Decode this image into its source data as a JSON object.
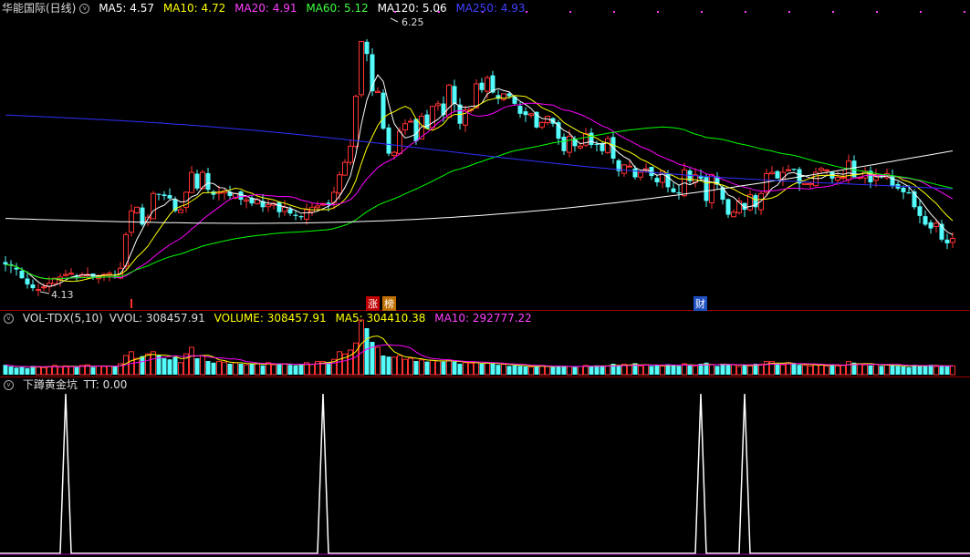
{
  "header": {
    "stock": "华能国际(日线)",
    "ma5": "MA5: 4.57",
    "ma10": "MA10: 4.72",
    "ma20": "MA20: 4.91",
    "ma60": "MA60: 5.12",
    "ma120": "MA120: 5.06",
    "ma250": "MA250: 4.93"
  },
  "vol_header": {
    "name": "VOL-TDX(5,10)",
    "vvol": "VVOL: 308457.91",
    "volume": "VOLUME: 308457.91",
    "ma5": "MA5: 304410.38",
    "ma10": "MA10: 292777.22"
  },
  "ind_header": {
    "name": "下蹲黄金坑",
    "tt": "TT: 0.00"
  },
  "annotations": {
    "high": "6.25",
    "low": "4.13",
    "mark_zhang": "涨",
    "mark_bang": "榜",
    "mark_cai": "财"
  },
  "colors": {
    "up": "#ff3232",
    "down": "#54fcfc",
    "ma5": "#ffffff",
    "ma10": "#ffff00",
    "ma20": "#ff00ff",
    "ma60": "#00ff00",
    "ma120": "#ffffff",
    "ma250": "#3030ff",
    "grid": "#a00000"
  },
  "chart_data": [
    {
      "type": "candlestick",
      "series": [
        {
          "name": "MA5"
        },
        {
          "name": "MA10"
        },
        {
          "name": "MA20"
        },
        {
          "name": "MA60"
        },
        {
          "name": "MA120"
        },
        {
          "name": "MA250"
        }
      ],
      "closes": [
        4.35,
        4.34,
        4.31,
        4.24,
        4.19,
        4.16,
        4.15,
        4.17,
        4.2,
        4.24,
        4.25,
        4.27,
        4.28,
        4.25,
        4.27,
        4.27,
        4.25,
        4.26,
        4.27,
        4.28,
        4.26,
        4.32,
        4.59,
        4.78,
        4.81,
        4.67,
        4.73,
        4.92,
        4.91,
        4.9,
        4.88,
        4.78,
        4.79,
        4.93,
        5.09,
        4.96,
        5.09,
        4.95,
        4.91,
        4.93,
        4.94,
        4.9,
        4.92,
        4.87,
        4.87,
        4.84,
        4.87,
        4.81,
        4.83,
        4.84,
        4.77,
        4.81,
        4.76,
        4.74,
        4.73,
        4.79,
        4.81,
        4.82,
        4.84,
        4.83,
        4.93,
        5.07,
        5.17,
        5.3,
        5.7,
        6.14,
        6.04,
        5.74,
        5.74,
        5.44,
        5.24,
        5.25,
        5.42,
        5.48,
        5.5,
        5.34,
        5.54,
        5.44,
        5.62,
        5.64,
        5.55,
        5.79,
        5.64,
        5.48,
        5.59,
        5.6,
        5.8,
        5.75,
        5.85,
        5.73,
        5.68,
        5.72,
        5.7,
        5.64,
        5.56,
        5.55,
        5.56,
        5.45,
        5.49,
        5.54,
        5.48,
        5.36,
        5.26,
        5.38,
        5.3,
        5.3,
        5.4,
        5.31,
        5.31,
        5.26,
        5.36,
        5.2,
        5.1,
        5.15,
        5.14,
        5.05,
        5.09,
        5.12,
        5.06,
        5.01,
        5.1,
        4.97,
        4.93,
        4.92,
        5.11,
        5.02,
        5.07,
        5.04,
        4.86,
        5.07,
        4.99,
        4.87,
        4.75,
        4.77,
        4.86,
        4.79,
        4.91,
        4.81,
        4.92,
        5.08,
        5.09,
        5.04,
        5.09,
        5.11,
        5.11,
        5.0,
        5.0,
        5.0,
        5.09,
        5.12,
        5.11,
        5.04,
        5.05,
        5.05,
        5.18,
        5.05,
        5.05,
        5.1,
        5.01,
        5.06,
        5.05,
        5.08,
        4.98,
        4.96,
        4.93,
        4.92,
        4.81,
        4.74,
        4.67,
        4.64,
        4.68,
        4.55,
        4.52,
        4.56
      ],
      "high": "6.25",
      "low": "4.13"
    },
    {
      "type": "bar",
      "series": [
        {
          "name": "VOLUME"
        },
        {
          "name": "MA5"
        },
        {
          "name": "MA10"
        }
      ],
      "values": [
        0.18,
        0.15,
        0.13,
        0.14,
        0.12,
        0.16,
        0.15,
        0.13,
        0.15,
        0.17,
        0.14,
        0.16,
        0.15,
        0.14,
        0.17,
        0.18,
        0.14,
        0.16,
        0.15,
        0.16,
        0.15,
        0.2,
        0.35,
        0.42,
        0.3,
        0.34,
        0.38,
        0.42,
        0.35,
        0.3,
        0.28,
        0.32,
        0.22,
        0.38,
        0.5,
        0.3,
        0.35,
        0.25,
        0.22,
        0.24,
        0.23,
        0.2,
        0.22,
        0.2,
        0.18,
        0.2,
        0.21,
        0.17,
        0.22,
        0.18,
        0.2,
        0.2,
        0.18,
        0.17,
        0.18,
        0.22,
        0.19,
        0.24,
        0.24,
        0.23,
        0.28,
        0.42,
        0.38,
        0.45,
        0.58,
        1.0,
        0.85,
        0.6,
        0.5,
        0.35,
        0.33,
        0.32,
        0.35,
        0.28,
        0.3,
        0.25,
        0.27,
        0.24,
        0.26,
        0.25,
        0.24,
        0.27,
        0.24,
        0.2,
        0.22,
        0.21,
        0.22,
        0.2,
        0.22,
        0.2,
        0.18,
        0.19,
        0.16,
        0.17,
        0.16,
        0.15,
        0.14,
        0.15,
        0.17,
        0.15,
        0.14,
        0.16,
        0.15,
        0.15,
        0.14,
        0.15,
        0.17,
        0.16,
        0.17,
        0.15,
        0.16,
        0.2,
        0.17,
        0.19,
        0.17,
        0.21,
        0.16,
        0.18,
        0.16,
        0.17,
        0.16,
        0.19,
        0.18,
        0.16,
        0.2,
        0.18,
        0.16,
        0.2,
        0.22,
        0.18,
        0.16,
        0.2,
        0.19,
        0.18,
        0.15,
        0.18,
        0.16,
        0.2,
        0.19,
        0.24,
        0.24,
        0.2,
        0.18,
        0.22,
        0.2,
        0.18,
        0.17,
        0.16,
        0.19,
        0.18,
        0.16,
        0.19,
        0.16,
        0.17,
        0.24,
        0.22,
        0.2,
        0.18,
        0.17,
        0.19,
        0.16,
        0.18,
        0.17,
        0.16,
        0.15,
        0.14,
        0.18,
        0.16,
        0.17,
        0.18,
        0.15,
        0.16,
        0.15,
        0.16
      ]
    },
    {
      "type": "line",
      "series": [
        {
          "name": "TT"
        }
      ],
      "peaks": [
        11,
        58,
        127,
        135
      ]
    }
  ]
}
